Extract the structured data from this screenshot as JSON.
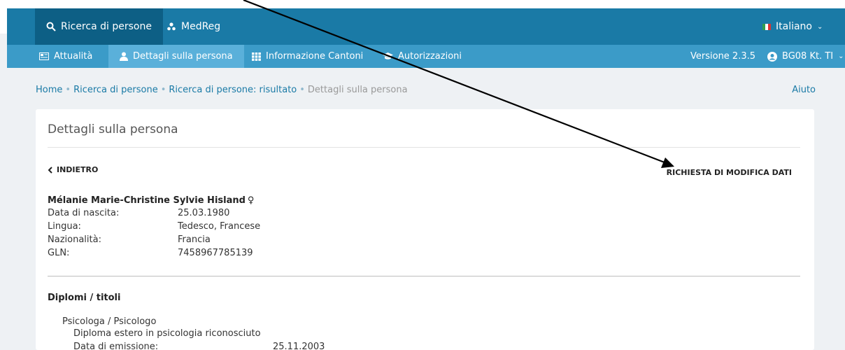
{
  "nav_primary": {
    "search_label": "Ricerca di persone",
    "medreg_label": "MedReg",
    "language_label": "Italiano"
  },
  "nav_secondary": {
    "news_label": "Attualità",
    "person_details_label": "Dettagli sulla persona",
    "cantons_label": "Informazione Cantoni",
    "authorizations_label": "Autorizzazioni",
    "version_label": "Versione 2.3.5",
    "user_label": "BG08 Kt. TI"
  },
  "breadcrumb": {
    "items": [
      "Home",
      "Ricerca di persone",
      "Ricerca di persone: risultato",
      "Dettagli sulla persona"
    ],
    "help_label": "Aiuto"
  },
  "card": {
    "title": "Dettagli sulla persona",
    "back_label": "INDIETRO",
    "modify_request_label": "RICHIESTA DI MODIFICA DATI"
  },
  "person": {
    "name": "Mélanie Marie-Christine Sylvie Hisland",
    "gender_symbol": "♀",
    "fields": [
      {
        "label": "Data di nascita:",
        "value": "25.03.1980"
      },
      {
        "label": "Lingua:",
        "value": "Tedesco, Francese"
      },
      {
        "label": "Nazionalità:",
        "value": "Francia"
      },
      {
        "label": "GLN:",
        "value": "7458967785139"
      }
    ]
  },
  "diplomas": {
    "section_title": "Diplomi / titoli",
    "items": [
      {
        "profession": "Psicologa / Psicologo",
        "title": "Diploma estero in psicologia riconosciuto",
        "issue_label": "Data di emissione:",
        "issue_date": "25.11.2003"
      }
    ]
  },
  "colors": {
    "primary_nav": "#1a7aa6",
    "secondary_nav": "#3b9bc8",
    "link": "#1a7aa6",
    "annotation_arrow": "#000000"
  },
  "icons": [
    "search-icon",
    "users-icon",
    "flag-it-icon",
    "chevron-down-icon",
    "news-icon",
    "person-icon",
    "grid-icon",
    "graduation-cap-icon",
    "user-circle-icon",
    "chevron-left-icon",
    "female-symbol-icon",
    "annotation-arrow"
  ]
}
